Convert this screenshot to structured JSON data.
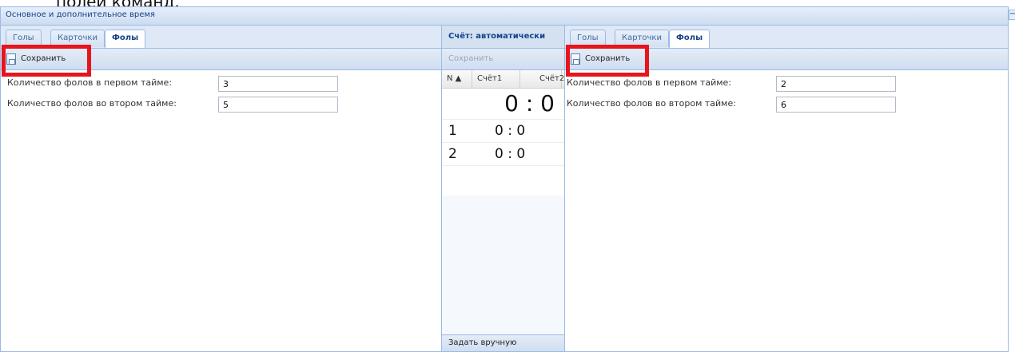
{
  "doc_fragment": "полей команд.",
  "window": {
    "title": "Основное и дополнительное время",
    "collapse_icon": "−"
  },
  "left_panel": {
    "tabs": [
      {
        "label": "Голы"
      },
      {
        "label": "Карточки"
      },
      {
        "label": "Фолы",
        "active": true
      }
    ],
    "save_label": "Сохранить",
    "fields": [
      {
        "label": "Количество фолов в первом тайме:",
        "value": "3"
      },
      {
        "label": "Количество фолов во втором тайме:",
        "value": "5"
      }
    ]
  },
  "center_panel": {
    "title": "Счёт: автоматически",
    "save_label": "Сохранить",
    "columns": {
      "n": "N ▲",
      "score1": "Счёт1",
      "score2": "Счёт2"
    },
    "total": "0 : 0",
    "rows": [
      {
        "n": "1",
        "score": "0 : 0"
      },
      {
        "n": "2",
        "score": "0 : 0"
      }
    ],
    "manual_button": "Задать вручную"
  },
  "right_panel": {
    "tabs": [
      {
        "label": "Голы"
      },
      {
        "label": "Карточки"
      },
      {
        "label": "Фолы",
        "active": true
      }
    ],
    "save_label": "Сохранить",
    "fields": [
      {
        "label": "Количество фолов в первом тайме:",
        "value": "2"
      },
      {
        "label": "Количество фолов во втором тайме:",
        "value": "6"
      }
    ]
  },
  "colors": {
    "highlight": "#e8141c",
    "border": "#99bbe8",
    "header_text": "#15428b"
  }
}
